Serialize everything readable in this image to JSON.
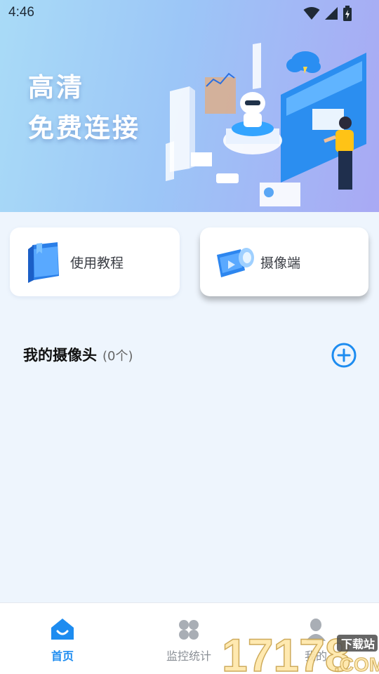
{
  "status_bar": {
    "time": "4:46"
  },
  "banner": {
    "line1": "高清",
    "line2": "免费连接"
  },
  "quick_actions": [
    {
      "label": "使用教程",
      "icon": "tutorial-book-icon"
    },
    {
      "label": "摄像端",
      "icon": "camera-endpoint-icon"
    }
  ],
  "my_cameras": {
    "title": "我的摄像头",
    "count": "(0个)",
    "add_icon": "add-circle-icon"
  },
  "bottom_nav": [
    {
      "label": "首页",
      "icon": "home-icon",
      "active": true
    },
    {
      "label": "监控统计",
      "icon": "grid-icon",
      "active": false
    },
    {
      "label": "我的",
      "icon": "person-icon",
      "active": false
    }
  ],
  "watermark": {
    "text": "17178",
    "suffix": ".COM",
    "tag": "下载站"
  },
  "colors": {
    "accent": "#1d8cf0",
    "background": "#eef5fd",
    "nav_inactive": "#8a8f96"
  }
}
